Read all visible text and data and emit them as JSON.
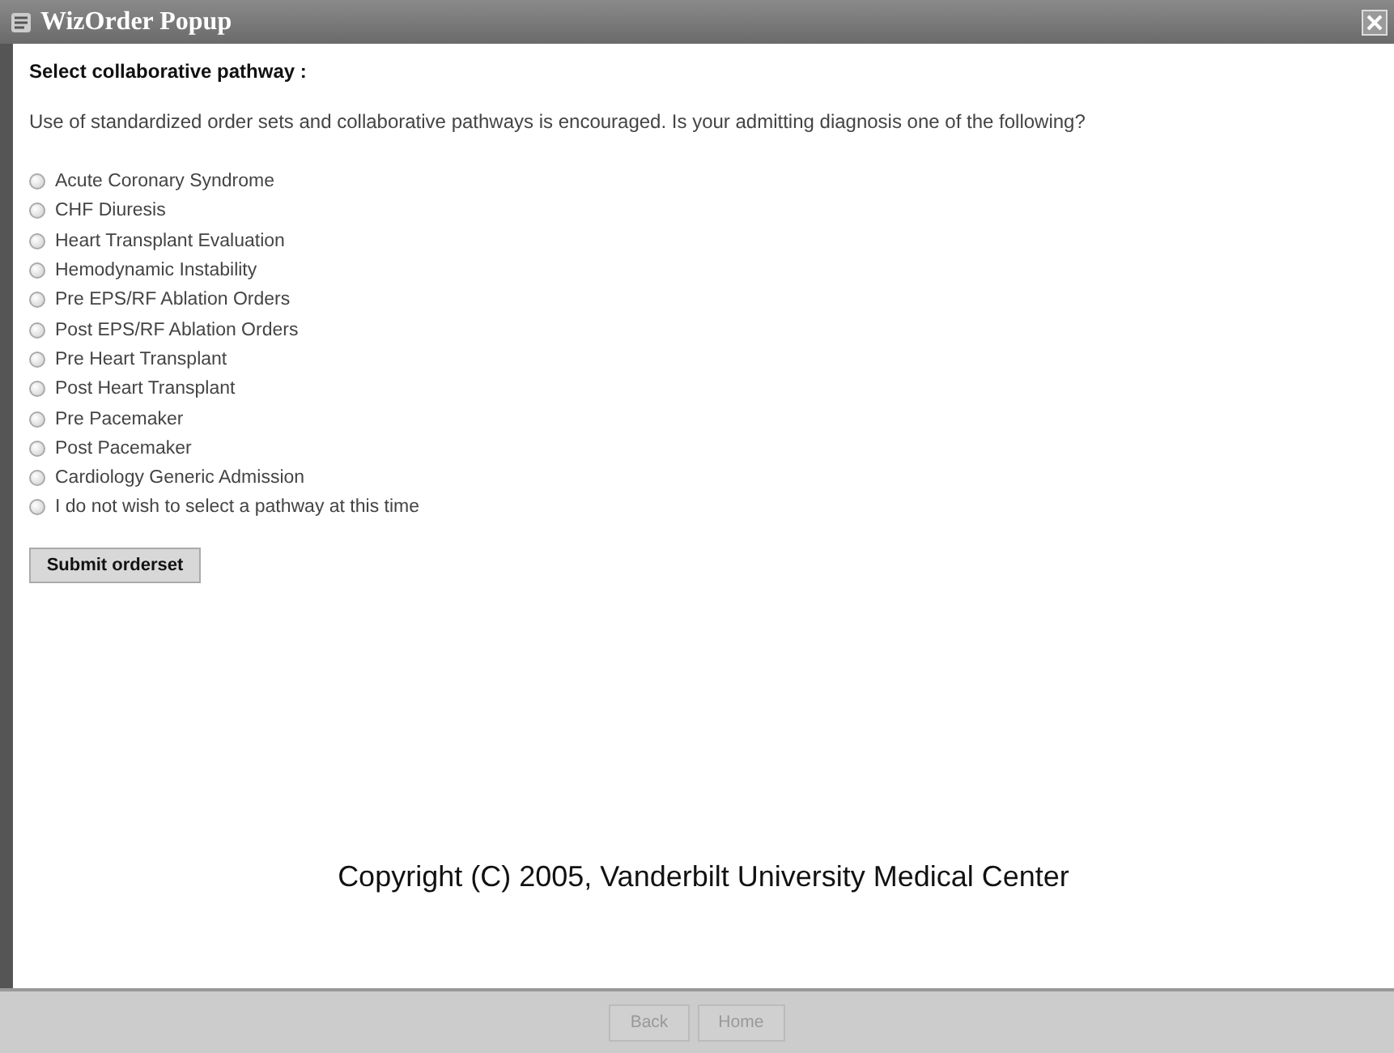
{
  "window": {
    "title": "WizOrder Popup"
  },
  "heading": "Select collaborative pathway :",
  "prompt": "Use of standardized order sets and collaborative pathways is encouraged. Is your admitting diagnosis one of the following?",
  "options": [
    {
      "label": "Acute Coronary Syndrome",
      "selected": false
    },
    {
      "label": "CHF Diuresis",
      "selected": false
    },
    {
      "label": "Heart Transplant Evaluation",
      "selected": false
    },
    {
      "label": "Hemodynamic Instability",
      "selected": false
    },
    {
      "label": "Pre EPS/RF Ablation Orders",
      "selected": false
    },
    {
      "label": "Post EPS/RF Ablation Orders",
      "selected": false
    },
    {
      "label": "Pre Heart Transplant",
      "selected": false
    },
    {
      "label": "Post Heart Transplant",
      "selected": false
    },
    {
      "label": "Pre Pacemaker",
      "selected": false
    },
    {
      "label": "Post Pacemaker",
      "selected": false
    },
    {
      "label": "Cardiology Generic Admission",
      "selected": false
    },
    {
      "label": "I do not wish to select a pathway at this time",
      "selected": false
    }
  ],
  "submit_button": "Submit orderset",
  "copyright": "Copyright (C) 2005, Vanderbilt University Medical Center",
  "footer_buttons": [
    {
      "label": "Back",
      "disabled": true
    },
    {
      "label": "Home",
      "disabled": true
    }
  ]
}
